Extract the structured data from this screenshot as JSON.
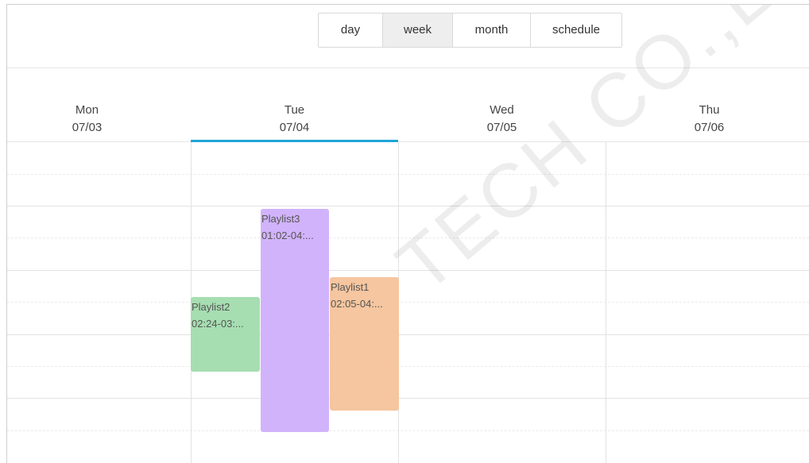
{
  "toolbar": {
    "views": [
      {
        "label": "day",
        "active": false
      },
      {
        "label": "week",
        "active": true
      },
      {
        "label": "month",
        "active": false
      },
      {
        "label": "schedule",
        "active": false
      }
    ]
  },
  "days": [
    {
      "dow": "Mon",
      "date": "07/03"
    },
    {
      "dow": "Tue",
      "date": "07/04",
      "selected": true
    },
    {
      "dow": "Wed",
      "date": "07/05"
    },
    {
      "dow": "Thu",
      "date": "07/06"
    }
  ],
  "events": [
    {
      "title": "Playlist3",
      "time": "01:02-04:...",
      "color": "#d1b3fb"
    },
    {
      "title": "Playlist2",
      "time": "02:24-03:...",
      "color": "#a6deb1"
    },
    {
      "title": "Playlist1",
      "time": "02:05-04:...",
      "color": "#f5c69f"
    }
  ],
  "colors": {
    "accent": "#1fa5d8",
    "active_tab_bg": "#eeeeee"
  },
  "watermark": {
    "text": "TECH CO.,LTD"
  }
}
